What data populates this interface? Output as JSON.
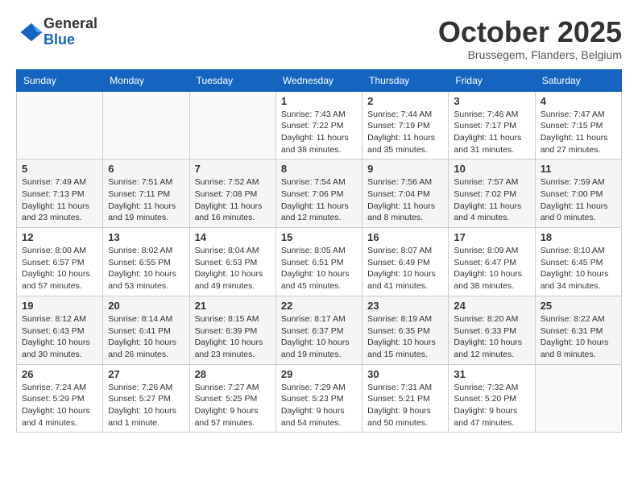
{
  "logo": {
    "general": "General",
    "blue": "Blue"
  },
  "title": "October 2025",
  "subtitle": "Brussegem, Flanders, Belgium",
  "days_of_week": [
    "Sunday",
    "Monday",
    "Tuesday",
    "Wednesday",
    "Thursday",
    "Friday",
    "Saturday"
  ],
  "weeks": [
    [
      {
        "day": "",
        "info": "",
        "empty": true
      },
      {
        "day": "",
        "info": "",
        "empty": true
      },
      {
        "day": "",
        "info": "",
        "empty": true
      },
      {
        "day": "1",
        "info": "Sunrise: 7:43 AM\nSunset: 7:22 PM\nDaylight: 11 hours\nand 38 minutes.",
        "empty": false
      },
      {
        "day": "2",
        "info": "Sunrise: 7:44 AM\nSunset: 7:19 PM\nDaylight: 11 hours\nand 35 minutes.",
        "empty": false
      },
      {
        "day": "3",
        "info": "Sunrise: 7:46 AM\nSunset: 7:17 PM\nDaylight: 11 hours\nand 31 minutes.",
        "empty": false
      },
      {
        "day": "4",
        "info": "Sunrise: 7:47 AM\nSunset: 7:15 PM\nDaylight: 11 hours\nand 27 minutes.",
        "empty": false
      }
    ],
    [
      {
        "day": "5",
        "info": "Sunrise: 7:49 AM\nSunset: 7:13 PM\nDaylight: 11 hours\nand 23 minutes.",
        "empty": false
      },
      {
        "day": "6",
        "info": "Sunrise: 7:51 AM\nSunset: 7:11 PM\nDaylight: 11 hours\nand 19 minutes.",
        "empty": false
      },
      {
        "day": "7",
        "info": "Sunrise: 7:52 AM\nSunset: 7:08 PM\nDaylight: 11 hours\nand 16 minutes.",
        "empty": false
      },
      {
        "day": "8",
        "info": "Sunrise: 7:54 AM\nSunset: 7:06 PM\nDaylight: 11 hours\nand 12 minutes.",
        "empty": false
      },
      {
        "day": "9",
        "info": "Sunrise: 7:56 AM\nSunset: 7:04 PM\nDaylight: 11 hours\nand 8 minutes.",
        "empty": false
      },
      {
        "day": "10",
        "info": "Sunrise: 7:57 AM\nSunset: 7:02 PM\nDaylight: 11 hours\nand 4 minutes.",
        "empty": false
      },
      {
        "day": "11",
        "info": "Sunrise: 7:59 AM\nSunset: 7:00 PM\nDaylight: 11 hours\nand 0 minutes.",
        "empty": false
      }
    ],
    [
      {
        "day": "12",
        "info": "Sunrise: 8:00 AM\nSunset: 6:57 PM\nDaylight: 10 hours\nand 57 minutes.",
        "empty": false
      },
      {
        "day": "13",
        "info": "Sunrise: 8:02 AM\nSunset: 6:55 PM\nDaylight: 10 hours\nand 53 minutes.",
        "empty": false
      },
      {
        "day": "14",
        "info": "Sunrise: 8:04 AM\nSunset: 6:53 PM\nDaylight: 10 hours\nand 49 minutes.",
        "empty": false
      },
      {
        "day": "15",
        "info": "Sunrise: 8:05 AM\nSunset: 6:51 PM\nDaylight: 10 hours\nand 45 minutes.",
        "empty": false
      },
      {
        "day": "16",
        "info": "Sunrise: 8:07 AM\nSunset: 6:49 PM\nDaylight: 10 hours\nand 41 minutes.",
        "empty": false
      },
      {
        "day": "17",
        "info": "Sunrise: 8:09 AM\nSunset: 6:47 PM\nDaylight: 10 hours\nand 38 minutes.",
        "empty": false
      },
      {
        "day": "18",
        "info": "Sunrise: 8:10 AM\nSunset: 6:45 PM\nDaylight: 10 hours\nand 34 minutes.",
        "empty": false
      }
    ],
    [
      {
        "day": "19",
        "info": "Sunrise: 8:12 AM\nSunset: 6:43 PM\nDaylight: 10 hours\nand 30 minutes.",
        "empty": false
      },
      {
        "day": "20",
        "info": "Sunrise: 8:14 AM\nSunset: 6:41 PM\nDaylight: 10 hours\nand 26 minutes.",
        "empty": false
      },
      {
        "day": "21",
        "info": "Sunrise: 8:15 AM\nSunset: 6:39 PM\nDaylight: 10 hours\nand 23 minutes.",
        "empty": false
      },
      {
        "day": "22",
        "info": "Sunrise: 8:17 AM\nSunset: 6:37 PM\nDaylight: 10 hours\nand 19 minutes.",
        "empty": false
      },
      {
        "day": "23",
        "info": "Sunrise: 8:19 AM\nSunset: 6:35 PM\nDaylight: 10 hours\nand 15 minutes.",
        "empty": false
      },
      {
        "day": "24",
        "info": "Sunrise: 8:20 AM\nSunset: 6:33 PM\nDaylight: 10 hours\nand 12 minutes.",
        "empty": false
      },
      {
        "day": "25",
        "info": "Sunrise: 8:22 AM\nSunset: 6:31 PM\nDaylight: 10 hours\nand 8 minutes.",
        "empty": false
      }
    ],
    [
      {
        "day": "26",
        "info": "Sunrise: 7:24 AM\nSunset: 5:29 PM\nDaylight: 10 hours\nand 4 minutes.",
        "empty": false
      },
      {
        "day": "27",
        "info": "Sunrise: 7:26 AM\nSunset: 5:27 PM\nDaylight: 10 hours\nand 1 minute.",
        "empty": false
      },
      {
        "day": "28",
        "info": "Sunrise: 7:27 AM\nSunset: 5:25 PM\nDaylight: 9 hours\nand 57 minutes.",
        "empty": false
      },
      {
        "day": "29",
        "info": "Sunrise: 7:29 AM\nSunset: 5:23 PM\nDaylight: 9 hours\nand 54 minutes.",
        "empty": false
      },
      {
        "day": "30",
        "info": "Sunrise: 7:31 AM\nSunset: 5:21 PM\nDaylight: 9 hours\nand 50 minutes.",
        "empty": false
      },
      {
        "day": "31",
        "info": "Sunrise: 7:32 AM\nSunset: 5:20 PM\nDaylight: 9 hours\nand 47 minutes.",
        "empty": false
      },
      {
        "day": "",
        "info": "",
        "empty": true
      }
    ]
  ]
}
